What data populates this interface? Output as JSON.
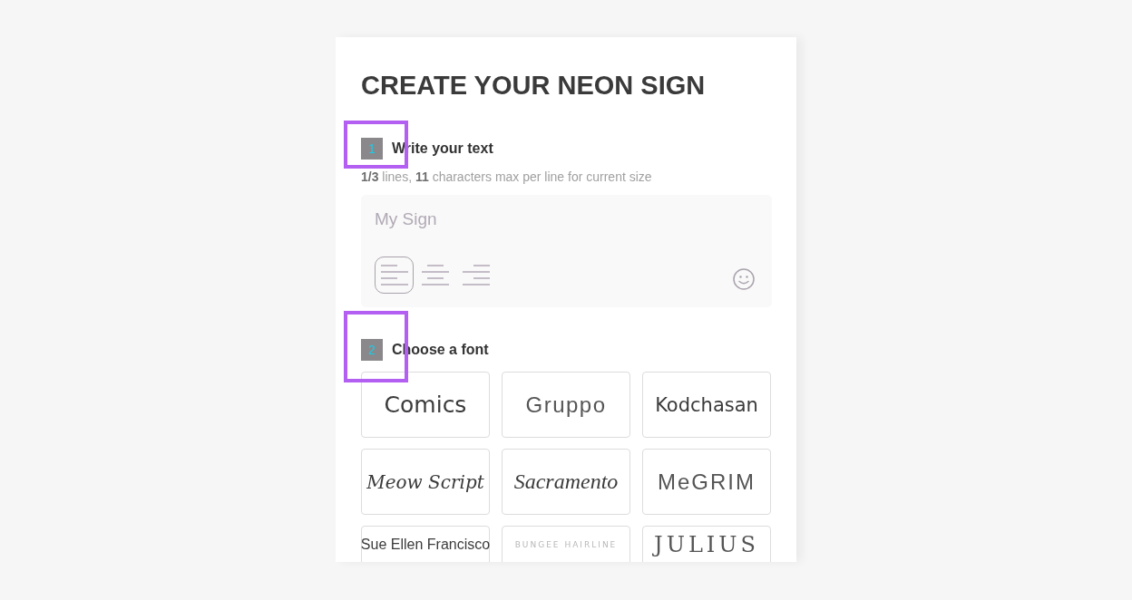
{
  "title": "CREATE YOUR NEON SIGN",
  "text_step": {
    "number": "1",
    "label": "Write your text",
    "highlighted": true,
    "hint": "**1/3** lines, **11** characters max per line for current size",
    "text_field": {
      "placeholder": "My Sign"
    },
    "alignments": [
      {
        "kind": "left",
        "selected": true
      },
      {
        "kind": "center",
        "selected": false
      },
      {
        "kind": "right",
        "selected": false
      }
    ]
  },
  "font_step": {
    "number": "2",
    "label": "Choose a font",
    "highlighted": true,
    "fonts": [
      {
        "name": "Comics",
        "selected": false
      },
      {
        "name": "Gruppo",
        "selected": false
      },
      {
        "name": "Kodchasan",
        "selected": false
      },
      {
        "name": "Meow Script",
        "selected": false
      },
      {
        "name": "Sacramento",
        "selected": false
      },
      {
        "name": "MeGRIM",
        "selected": false
      },
      {
        "name": "Sue Ellen Francisco",
        "selected": false
      },
      {
        "name": "BUNGEE HAIRLINE",
        "selected": false
      },
      {
        "name": "JULIUS",
        "selected": false
      }
    ]
  }
}
